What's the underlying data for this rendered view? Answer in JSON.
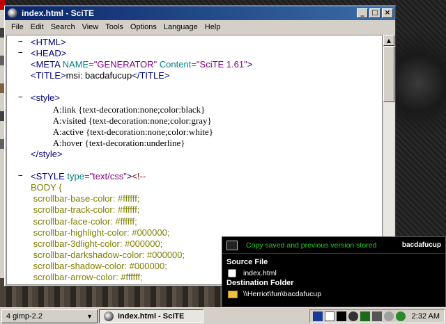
{
  "window": {
    "title": "index.html - SciTE",
    "minimize": "_",
    "maximize": "□",
    "close": "×"
  },
  "menu": [
    "File",
    "Edit",
    "Search",
    "View",
    "Tools",
    "Options",
    "Language",
    "Help"
  ],
  "editor": {
    "lines": [
      {
        "fold": "−",
        "font": "sans",
        "parts": [
          {
            "t": "<HTML>",
            "c": "tag"
          }
        ]
      },
      {
        "fold": "−",
        "font": "sans",
        "parts": [
          {
            "t": "<HEAD>",
            "c": "tag"
          }
        ]
      },
      {
        "fold": "",
        "font": "sans",
        "parts": [
          {
            "t": "<META ",
            "c": "tag"
          },
          {
            "t": "NAME=",
            "c": "attr"
          },
          {
            "t": "\"GENERATOR\"",
            "c": "str"
          },
          {
            "t": " Content=",
            "c": "attr"
          },
          {
            "t": "\"SciTE 1.61\"",
            "c": "str"
          },
          {
            "t": ">",
            "c": "tag"
          }
        ]
      },
      {
        "fold": "",
        "font": "sans",
        "parts": [
          {
            "t": "<TITLE>",
            "c": "tag"
          },
          {
            "t": "msi: bacdafucup",
            "c": "blk"
          },
          {
            "t": "</TITLE>",
            "c": "tag"
          }
        ]
      },
      {
        "fold": "",
        "font": "sans",
        "parts": []
      },
      {
        "fold": "−",
        "font": "sans",
        "parts": [
          {
            "t": "<style>",
            "c": "tag"
          }
        ]
      },
      {
        "fold": "",
        "font": "serif",
        "parts": [
          {
            "t": "          A:link {text-decoration:none;color:black}",
            "c": "blk"
          }
        ]
      },
      {
        "fold": "",
        "font": "serif",
        "parts": [
          {
            "t": "          A:visited {text-decoration:none;color:gray}",
            "c": "blk"
          }
        ]
      },
      {
        "fold": "",
        "font": "serif",
        "parts": [
          {
            "t": "          A:active {text-decoration:none;color:white}",
            "c": "blk"
          }
        ]
      },
      {
        "fold": "",
        "font": "serif",
        "parts": [
          {
            "t": "          A:hover {text-decoration:underline}",
            "c": "blk"
          }
        ]
      },
      {
        "fold": "",
        "font": "sans",
        "parts": [
          {
            "t": "</style>",
            "c": "tag"
          }
        ]
      },
      {
        "fold": "",
        "font": "sans",
        "parts": []
      },
      {
        "fold": "−",
        "font": "sans",
        "parts": [
          {
            "t": "<STYLE ",
            "c": "tag"
          },
          {
            "t": "type=",
            "c": "attr"
          },
          {
            "t": "\"text/css\"",
            "c": "str"
          },
          {
            "t": ">",
            "c": "tag"
          },
          {
            "t": "<!--",
            "c": "cmt"
          }
        ]
      },
      {
        "fold": "",
        "font": "sans",
        "parts": [
          {
            "t": "BODY {",
            "c": "css"
          }
        ]
      },
      {
        "fold": "",
        "font": "sans",
        "parts": [
          {
            "t": " scrollbar-base-color: #ffffff;",
            "c": "css"
          }
        ]
      },
      {
        "fold": "",
        "font": "sans",
        "parts": [
          {
            "t": " scrollbar-track-color: #ffffff;",
            "c": "css"
          }
        ]
      },
      {
        "fold": "",
        "font": "sans",
        "parts": [
          {
            "t": " scrollbar-face-color: #ffffff;",
            "c": "css"
          }
        ]
      },
      {
        "fold": "",
        "font": "sans",
        "parts": [
          {
            "t": " scrollbar-highlight-color: #000000;",
            "c": "css"
          }
        ]
      },
      {
        "fold": "",
        "font": "sans",
        "parts": [
          {
            "t": " scrollbar-3dlight-color: #000000;",
            "c": "css"
          }
        ]
      },
      {
        "fold": "",
        "font": "sans",
        "parts": [
          {
            "t": " scrollbar-darkshadow-color: #000000;",
            "c": "css"
          }
        ]
      },
      {
        "fold": "",
        "font": "sans",
        "parts": [
          {
            "t": " scrollbar-shadow-color: #000000;",
            "c": "css"
          }
        ]
      },
      {
        "fold": "",
        "font": "sans",
        "parts": [
          {
            "t": " scrollbar-arrow-color: #ffffff;",
            "c": "css"
          }
        ]
      }
    ]
  },
  "notification": {
    "message": "Copy saved and previous version stored",
    "name": "bacdafucup",
    "source_label": "Source File",
    "source_value": "index.html",
    "dest_label": "Destination Folder",
    "dest_value": "\\\\Herriot\\fun\\bacdafucup"
  },
  "taskbar": {
    "gimp": "4 gimp-2.2",
    "gimp_dropdown": "▼",
    "scite": "index.html - SciTE",
    "clock": "2:32 AM"
  },
  "colors": {
    "title_start": "#0a246a",
    "title_end": "#3a6ea5",
    "notify_green": "#22cc22"
  }
}
